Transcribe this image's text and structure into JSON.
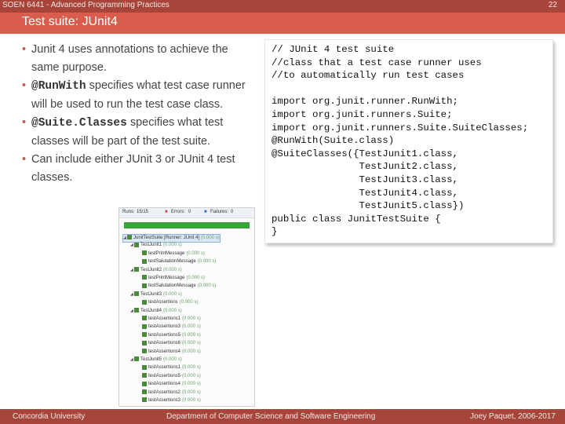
{
  "header": {
    "course": "SOEN 6441 - Advanced Programming Practices",
    "slide_number": "22"
  },
  "title": "Test suite: JUnit4",
  "bullets": [
    {
      "pre": "",
      "code": "",
      "text": "Junit 4 uses annotations to achieve the same purpose."
    },
    {
      "pre": "",
      "code": "@RunWith",
      "text": " specifies what test case runner will be used to run the test case class."
    },
    {
      "pre": "",
      "code": "@Suite.Classes",
      "text": " specifies what test classes will be part of the test suite."
    },
    {
      "pre": "",
      "code": "",
      "text": "Can include either JUnit 3 or JUnit 4 test classes."
    }
  ],
  "code_lines": [
    "// JUnit 4 test suite",
    "//class that a test case runner uses",
    "//to automatically run test cases",
    "",
    "import org.junit.runner.RunWith;",
    "import org.junit.runners.Suite;",
    "import org.junit.runners.Suite.SuiteClasses;",
    "@RunWith(Suite.class)",
    "@SuiteClasses({TestJunit1.class,",
    "               TestJunit2.class,",
    "               TestJunit3.class,",
    "               TestJunit4.class,",
    "               TestJunit5.class})",
    "public class JunitTestSuite {",
    "}"
  ],
  "junit_view": {
    "runs_label": "Runs:",
    "runs_value": "15/15",
    "errors_label": "Errors:",
    "errors_value": "0",
    "failures_label": "Failures:",
    "failures_value": "0",
    "rows": [
      {
        "label": "JunitTestSuite [Runner: JUnit 4]",
        "time": "(0.000 s)",
        "level": 0,
        "selected": true
      },
      {
        "label": "TestJunit1",
        "time": "(0.000 s)",
        "level": 1
      },
      {
        "label": "testPrintMessage",
        "time": "(0.000 s)",
        "level": 2
      },
      {
        "label": "testSalutationMessage",
        "time": "(0.000 s)",
        "level": 2
      },
      {
        "label": "TestJunit2",
        "time": "(0.000 s)",
        "level": 1
      },
      {
        "label": "testPrintMessage",
        "time": "(0.000 s)",
        "level": 2
      },
      {
        "label": "testSalutationMessage",
        "time": "(0.000 s)",
        "level": 2
      },
      {
        "label": "TestJunit3",
        "time": "(0.000 s)",
        "level": 1
      },
      {
        "label": "testAssertions",
        "time": "(0.000 s)",
        "level": 2
      },
      {
        "label": "TestJunit4",
        "time": "(0.000 s)",
        "level": 1
      },
      {
        "label": "testAssertions1",
        "time": "(0.000 s)",
        "level": 2
      },
      {
        "label": "testAssertions3",
        "time": "(0.000 s)",
        "level": 2
      },
      {
        "label": "testAssertions5",
        "time": "(0.000 s)",
        "level": 2
      },
      {
        "label": "testAssertions6",
        "time": "(0.000 s)",
        "level": 2
      },
      {
        "label": "testAssertions4",
        "time": "(0.000 s)",
        "level": 2
      },
      {
        "label": "TestJunit5",
        "time": "(0.000 s)",
        "level": 1
      },
      {
        "label": "testAssertions1",
        "time": "(0.000 s)",
        "level": 2
      },
      {
        "label": "testAssertions5",
        "time": "(0.000 s)",
        "level": 2
      },
      {
        "label": "testAssertions4",
        "time": "(0.000 s)",
        "level": 2
      },
      {
        "label": "testAssertions2",
        "time": "(0.000 s)",
        "level": 2
      },
      {
        "label": "testAssertions3",
        "time": "(0.000 s)",
        "level": 2
      }
    ]
  },
  "footer": {
    "left": "Concordia University",
    "center": "Department of Computer Science and Software Engineering",
    "right": "Joey Paquet, 2006-2017"
  }
}
